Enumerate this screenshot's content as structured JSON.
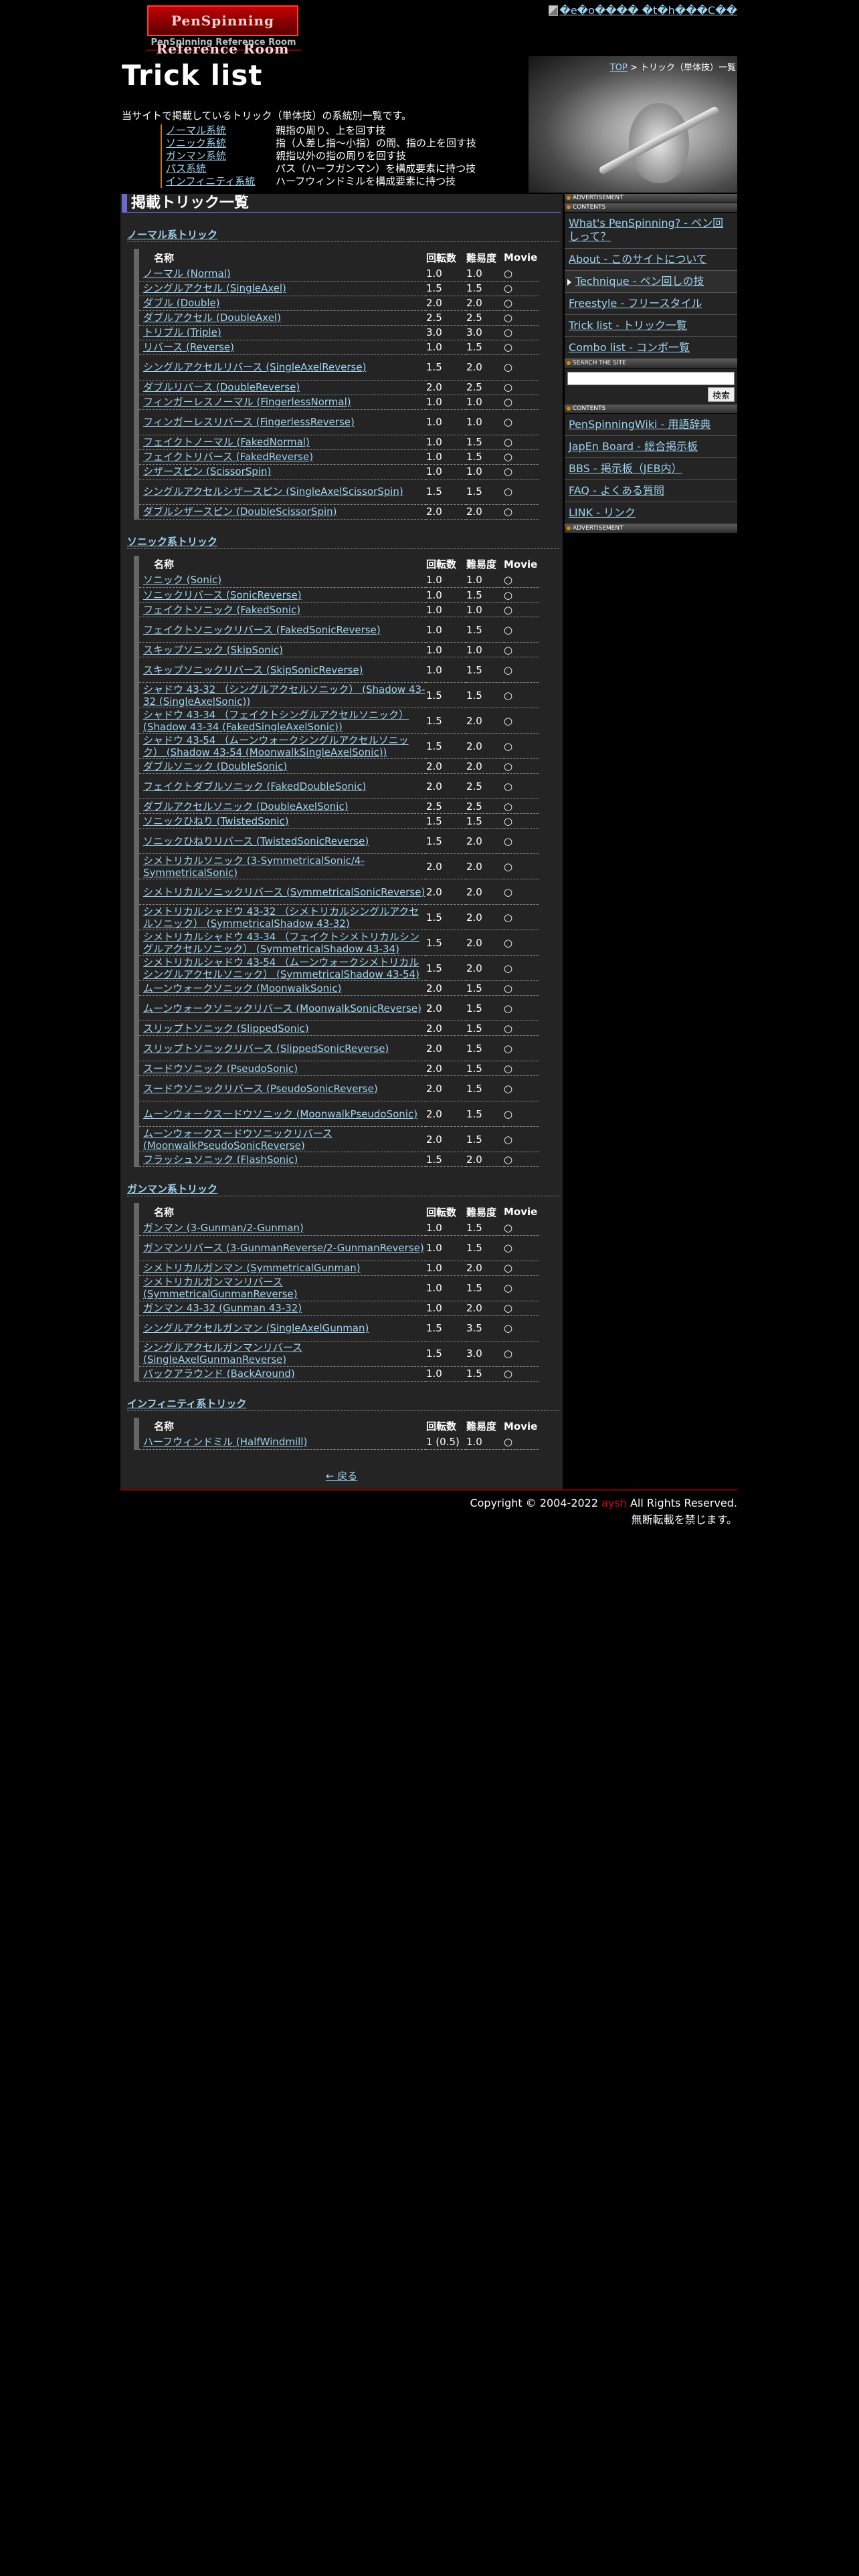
{
  "header": {
    "logo_text": "PenSpinning Reference Room",
    "logo_sub": "PenSpinning Reference Room",
    "banner_alt": "�e�o���� �t�h���C��",
    "page_title": "Trick list",
    "breadcrumb_top": "TOP",
    "breadcrumb_rest": " > トリック（単体技）一覧",
    "intro": "当サイトで掲載しているトリック（単体技）の系統別一覧です。"
  },
  "categories": [
    {
      "name": "ノーマル系統",
      "desc": "親指の周り、上を回す技"
    },
    {
      "name": "ソニック系統",
      "desc": "指（人差し指〜小指）の間、指の上を回す技"
    },
    {
      "name": "ガンマン系統",
      "desc": "親指以外の指の周りを回す技"
    },
    {
      "name": "パス系統",
      "desc": "パス（ハーフガンマン）を構成要素に持つ技"
    },
    {
      "name": "インフィニティ系統",
      "desc": "ハーフウィンドミルを構成要素に持つ技"
    }
  ],
  "main": {
    "heading": "掲載トリック一覧",
    "col_name": "名称",
    "col_rotation": "回転数",
    "col_difficulty": "難易度",
    "col_movie": "Movie",
    "back": "← 戻る"
  },
  "sections": [
    {
      "title": "ノーマル系トリック",
      "rows": [
        {
          "name": "ノーマル (Normal)",
          "rot": "1.0",
          "diff": "1.0",
          "movie": "○"
        },
        {
          "name": "シングルアクセル (SingleAxel)",
          "rot": "1.5",
          "diff": "1.5",
          "movie": "○"
        },
        {
          "name": "ダブル (Double)",
          "rot": "2.0",
          "diff": "2.0",
          "movie": "○"
        },
        {
          "name": "ダブルアクセル (DoubleAxel)",
          "rot": "2.5",
          "diff": "2.5",
          "movie": "○"
        },
        {
          "name": "トリプル (Triple)",
          "rot": "3.0",
          "diff": "3.0",
          "movie": "○"
        },
        {
          "name": "リバース (Reverse)",
          "rot": "1.0",
          "diff": "1.5",
          "movie": "○"
        },
        {
          "name": "シングルアクセルリバース (SingleAxelReverse)",
          "rot": "1.5",
          "diff": "2.0",
          "movie": "○"
        },
        {
          "name": "ダブルリバース (DoubleReverse)",
          "rot": "2.0",
          "diff": "2.5",
          "movie": "○"
        },
        {
          "name": "フィンガーレスノーマル (FingerlessNormal)",
          "rot": "1.0",
          "diff": "1.0",
          "movie": "○"
        },
        {
          "name": "フィンガーレスリバース (FingerlessReverse)",
          "rot": "1.0",
          "diff": "1.0",
          "movie": "○"
        },
        {
          "name": "フェイクトノーマル (FakedNormal)",
          "rot": "1.0",
          "diff": "1.5",
          "movie": "○"
        },
        {
          "name": "フェイクトリバース (FakedReverse)",
          "rot": "1.0",
          "diff": "1.5",
          "movie": "○"
        },
        {
          "name": "シザースピン (ScissorSpin)",
          "rot": "1.0",
          "diff": "1.0",
          "movie": "○"
        },
        {
          "name": "シングルアクセルシザースピン (SingleAxelScissorSpin)",
          "rot": "1.5",
          "diff": "1.5",
          "movie": "○"
        },
        {
          "name": "ダブルシザースピン (DoubleScissorSpin)",
          "rot": "2.0",
          "diff": "2.0",
          "movie": "○"
        }
      ]
    },
    {
      "title": "ソニック系トリック",
      "rows": [
        {
          "name": "ソニック (Sonic)",
          "rot": "1.0",
          "diff": "1.0",
          "movie": "○"
        },
        {
          "name": "ソニックリバース (SonicReverse)",
          "rot": "1.0",
          "diff": "1.5",
          "movie": "○"
        },
        {
          "name": "フェイクトソニック (FakedSonic)",
          "rot": "1.0",
          "diff": "1.0",
          "movie": "○"
        },
        {
          "name": "フェイクトソニックリバース (FakedSonicReverse)",
          "rot": "1.0",
          "diff": "1.5",
          "movie": "○"
        },
        {
          "name": "スキップソニック (SkipSonic)",
          "rot": "1.0",
          "diff": "1.0",
          "movie": "○"
        },
        {
          "name": "スキップソニックリバース (SkipSonicReverse)",
          "rot": "1.0",
          "diff": "1.5",
          "movie": "○"
        },
        {
          "name": "シャドウ 43-32 （シングルアクセルソニック） (Shadow 43-32 (SingleAxelSonic))",
          "rot": "1.5",
          "diff": "1.5",
          "movie": "○"
        },
        {
          "name": "シャドウ 43-34 （フェイクトシングルアクセルソニック） (Shadow 43-34 (FakedSingleAxelSonic))",
          "rot": "1.5",
          "diff": "2.0",
          "movie": "○"
        },
        {
          "name": "シャドウ 43-54 （ムーンウォークシングルアクセルソニック） (Shadow 43-54 (MoonwalkSingleAxelSonic))",
          "rot": "1.5",
          "diff": "2.0",
          "movie": "○"
        },
        {
          "name": "ダブルソニック (DoubleSonic)",
          "rot": "2.0",
          "diff": "2.0",
          "movie": "○"
        },
        {
          "name": "フェイクトダブルソニック (FakedDoubleSonic)",
          "rot": "2.0",
          "diff": "2.5",
          "movie": "○"
        },
        {
          "name": "ダブルアクセルソニック (DoubleAxelSonic)",
          "rot": "2.5",
          "diff": "2.5",
          "movie": "○"
        },
        {
          "name": "ソニックひねり (TwistedSonic)",
          "rot": "1.5",
          "diff": "1.5",
          "movie": "○"
        },
        {
          "name": "ソニックひねりリバース (TwistedSonicReverse)",
          "rot": "1.5",
          "diff": "2.0",
          "movie": "○"
        },
        {
          "name": "シメトリカルソニック (3-SymmetricalSonic/4-SymmetricalSonic)",
          "rot": "2.0",
          "diff": "2.0",
          "movie": "○"
        },
        {
          "name": "シメトリカルソニックリバース (SymmetricalSonicReverse)",
          "rot": "2.0",
          "diff": "2.0",
          "movie": "○"
        },
        {
          "name": "シメトリカルシャドウ 43-32 （シメトリカルシングルアクセルソニック） (SymmetricalShadow 43-32)",
          "rot": "1.5",
          "diff": "2.0",
          "movie": "○"
        },
        {
          "name": "シメトリカルシャドウ 43-34 （フェイクトシメトリカルシングルアクセルソニック） (SymmetricalShadow 43-34)",
          "rot": "1.5",
          "diff": "2.0",
          "movie": "○"
        },
        {
          "name": "シメトリカルシャドウ 43-54 （ムーンウォークシメトリカルシングルアクセルソニック） (SymmetricalShadow 43-54)",
          "rot": "1.5",
          "diff": "2.0",
          "movie": "○"
        },
        {
          "name": "ムーンウォークソニック (MoonwalkSonic)",
          "rot": "2.0",
          "diff": "1.5",
          "movie": "○"
        },
        {
          "name": "ムーンウォークソニックリバース (MoonwalkSonicReverse)",
          "rot": "2.0",
          "diff": "1.5",
          "movie": "○"
        },
        {
          "name": "スリップトソニック (SlippedSonic)",
          "rot": "2.0",
          "diff": "1.5",
          "movie": "○"
        },
        {
          "name": "スリップトソニックリバース (SlippedSonicReverse)",
          "rot": "2.0",
          "diff": "1.5",
          "movie": "○"
        },
        {
          "name": "スードウソニック (PseudoSonic)",
          "rot": "2.0",
          "diff": "1.5",
          "movie": "○"
        },
        {
          "name": "スードウソニックリバース (PseudoSonicReverse)",
          "rot": "2.0",
          "diff": "1.5",
          "movie": "○"
        },
        {
          "name": "ムーンウォークスードウソニック (MoonwalkPseudoSonic)",
          "rot": "2.0",
          "diff": "1.5",
          "movie": "○"
        },
        {
          "name": "ムーンウォークスードウソニックリバース (MoonwalkPseudoSonicReverse)",
          "rot": "2.0",
          "diff": "1.5",
          "movie": "○"
        },
        {
          "name": "フラッシュソニック (FlashSonic)",
          "rot": "1.5",
          "diff": "2.0",
          "movie": "○"
        }
      ]
    },
    {
      "title": "ガンマン系トリック",
      "rows": [
        {
          "name": "ガンマン (3-Gunman/2-Gunman)",
          "rot": "1.0",
          "diff": "1.5",
          "movie": "○"
        },
        {
          "name": "ガンマンリバース (3-GunmanReverse/2-GunmanReverse)",
          "rot": "1.0",
          "diff": "1.5",
          "movie": "○"
        },
        {
          "name": "シメトリカルガンマン (SymmetricalGunman)",
          "rot": "1.0",
          "diff": "2.0",
          "movie": "○"
        },
        {
          "name": "シメトリカルガンマンリバース (SymmetricalGunmanReverse)",
          "rot": "1.0",
          "diff": "1.5",
          "movie": "○"
        },
        {
          "name": "ガンマン 43-32 (Gunman 43-32)",
          "rot": "1.0",
          "diff": "2.0",
          "movie": "○"
        },
        {
          "name": "シングルアクセルガンマン (SingleAxelGunman)",
          "rot": "1.5",
          "diff": "3.5",
          "movie": "○"
        },
        {
          "name": "シングルアクセルガンマンリバース (SingleAxelGunmanReverse)",
          "rot": "1.5",
          "diff": "3.0",
          "movie": "○"
        },
        {
          "name": "バックアラウンド (BackAround)",
          "rot": "1.0",
          "diff": "1.5",
          "movie": "○"
        }
      ]
    },
    {
      "title": "インフィニティ系トリック",
      "rows": [
        {
          "name": "ハーフウィンドミル (HalfWindmill)",
          "rot": "1 (0.5)",
          "diff": "1.0",
          "movie": "○"
        }
      ]
    }
  ],
  "sidebar": {
    "advertisement_label": "ADVERTISEMENT",
    "contents_label": "CONTENTS",
    "search_label": "SEARCH THE SITE",
    "search_button": "検索",
    "nav1": [
      {
        "label": "What's PenSpinning? - ペン回しって？"
      },
      {
        "label": "About - このサイトについて"
      },
      {
        "label": "Technique - ペン回しの技"
      },
      {
        "label": "Freestyle - フリースタイル"
      },
      {
        "label": "Trick list - トリック一覧"
      },
      {
        "label": "Combo list - コンボ一覧"
      }
    ],
    "nav2": [
      {
        "label": "PenSpinningWiki - 用語辞典"
      },
      {
        "label": "JapEn Board - 総合掲示板"
      },
      {
        "label": "BBS - 掲示板（JEB内）"
      },
      {
        "label": "FAQ - よくある質問"
      },
      {
        "label": "LINK - リンク"
      }
    ]
  },
  "footer": {
    "copyright_pre": "Copyright © 2004-2022 ",
    "author": "aysh",
    "copyright_post": " All Rights Reserved.",
    "notice": "無断転載を禁じます。"
  }
}
